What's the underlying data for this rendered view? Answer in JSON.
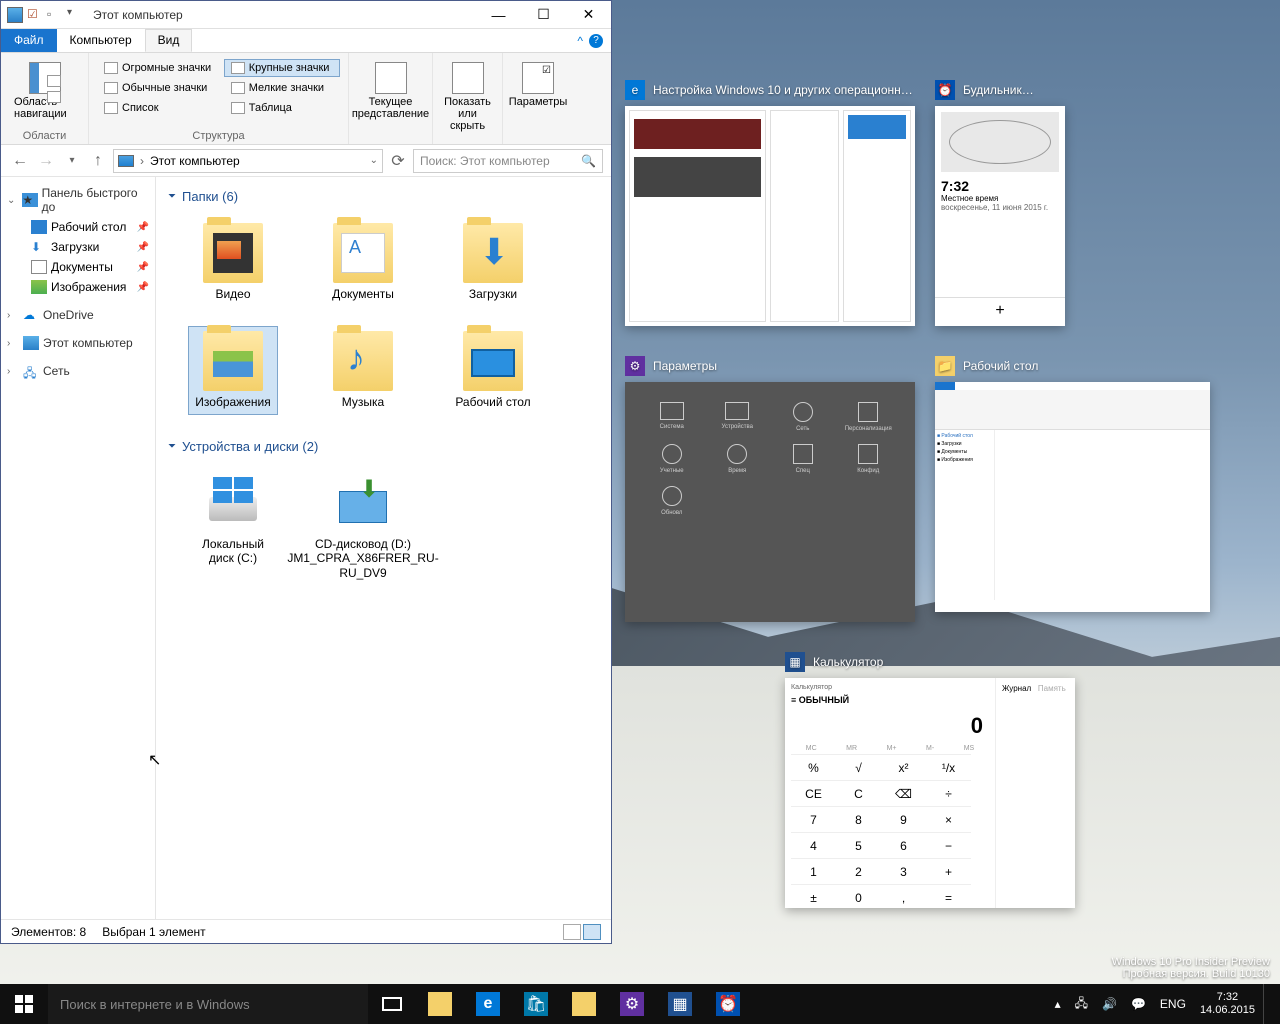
{
  "explorer": {
    "title": "Этот компьютер",
    "tabs": {
      "file": "Файл",
      "computer": "Компьютер",
      "view": "Вид"
    },
    "ribbon": {
      "nav_panel": "Область навигации",
      "group_areas": "Области",
      "views": {
        "huge": "Огромные значки",
        "large": "Крупные значки",
        "normal": "Обычные значки",
        "small": "Мелкие значки",
        "list": "Список",
        "table": "Таблица"
      },
      "group_layout": "Структура",
      "current_view": "Текущее представление",
      "show_hide": "Показать или скрыть",
      "options": "Параметры"
    },
    "address": "Этот компьютер",
    "search_placeholder": "Поиск: Этот компьютер",
    "sidebar": {
      "quick": "Панель быстрого до",
      "desktop": "Рабочий стол",
      "downloads": "Загрузки",
      "documents": "Документы",
      "pictures": "Изображения",
      "onedrive": "OneDrive",
      "this_pc": "Этот компьютер",
      "network": "Сеть"
    },
    "sections": {
      "folders": "Папки (6)",
      "devices": "Устройства и диски (2)"
    },
    "folders": [
      {
        "label": "Видео"
      },
      {
        "label": "Документы"
      },
      {
        "label": "Загрузки"
      },
      {
        "label": "Изображения"
      },
      {
        "label": "Музыка"
      },
      {
        "label": "Рабочий стол"
      }
    ],
    "drives": [
      {
        "label": "Локальный диск (C:)"
      },
      {
        "label": "CD-дисковод (D:) JM1_CPRA_X86FRER_RU-RU_DV9"
      }
    ],
    "status": {
      "items": "Элементов: 8",
      "selected": "Выбран 1 элемент"
    }
  },
  "taskview": {
    "w1": "Настройка Windows 10 и других операционн…",
    "w2": "Будильник…",
    "w3": "Параметры",
    "w4": "Рабочий стол",
    "w5": "Калькулятор"
  },
  "alarm": {
    "time": "7:32",
    "label": "Местное время",
    "date": "воскресенье, 11 июня 2015 г."
  },
  "calc": {
    "title": "Калькулятор",
    "mode": "ОБЫЧНЫЙ",
    "display": "0",
    "journal": "Журнал",
    "memory": "Память",
    "keys": [
      "%",
      "√",
      "x²",
      "¹/x",
      "CE",
      "C",
      "⌫",
      "÷",
      "7",
      "8",
      "9",
      "×",
      "4",
      "5",
      "6",
      "−",
      "1",
      "2",
      "3",
      "+",
      "±",
      "0",
      ",",
      "="
    ]
  },
  "taskbar": {
    "search": "Поиск в интернете и в Windows",
    "lang": "ENG",
    "time": "7:32",
    "date": "14.06.2015"
  },
  "watermark": {
    "l1": "Windows 10 Pro Insider Preview",
    "l2": "Пробная версия. Build 10130"
  }
}
